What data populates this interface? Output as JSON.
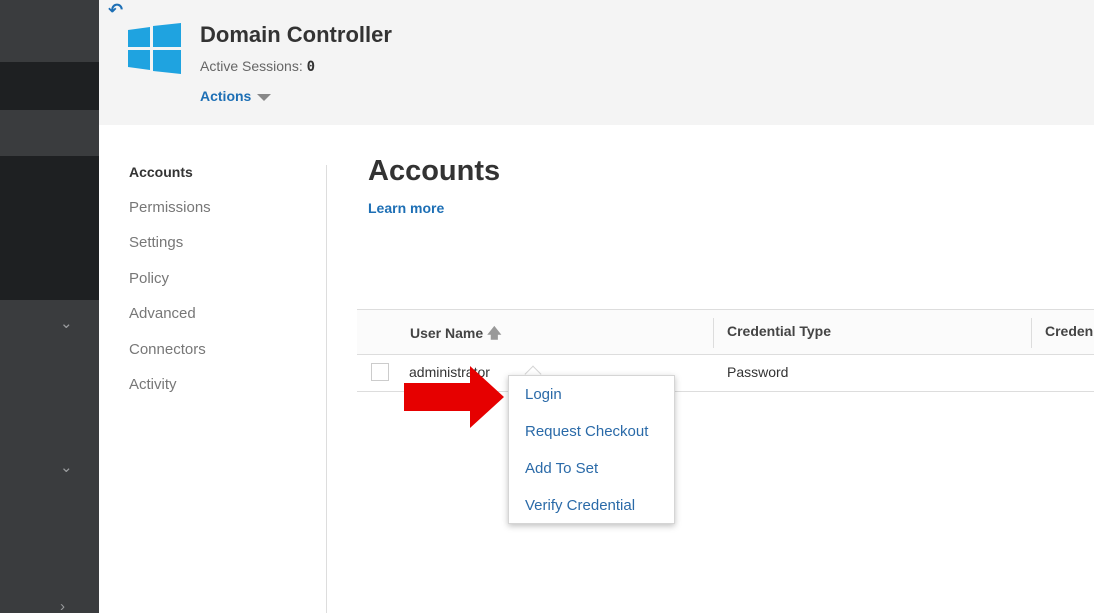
{
  "header": {
    "title": "Domain Controller",
    "sessions_label": "Active Sessions:",
    "sessions_count": "0",
    "actions_label": "Actions"
  },
  "icons": {
    "back": "back-arrow-icon",
    "logo": "windows-logo-icon"
  },
  "colors": {
    "accent": "#1d6fb5",
    "rail": "#2f3133",
    "annotation_arrow": "#e60000"
  },
  "nav": {
    "items": [
      {
        "label": "Accounts",
        "active": true
      },
      {
        "label": "Permissions"
      },
      {
        "label": "Settings"
      },
      {
        "label": "Policy"
      },
      {
        "label": "Advanced"
      },
      {
        "label": "Connectors"
      },
      {
        "label": "Activity"
      }
    ]
  },
  "main": {
    "title": "Accounts",
    "learn_more": "Learn more"
  },
  "table": {
    "columns": [
      "User Name",
      "Credential Type",
      "Creden"
    ],
    "rows": [
      {
        "user_name": "administrator",
        "credential_type": "Password"
      }
    ]
  },
  "context_menu": {
    "items": [
      "Login",
      "Request Checkout",
      "Add To Set",
      "Verify Credential"
    ]
  }
}
